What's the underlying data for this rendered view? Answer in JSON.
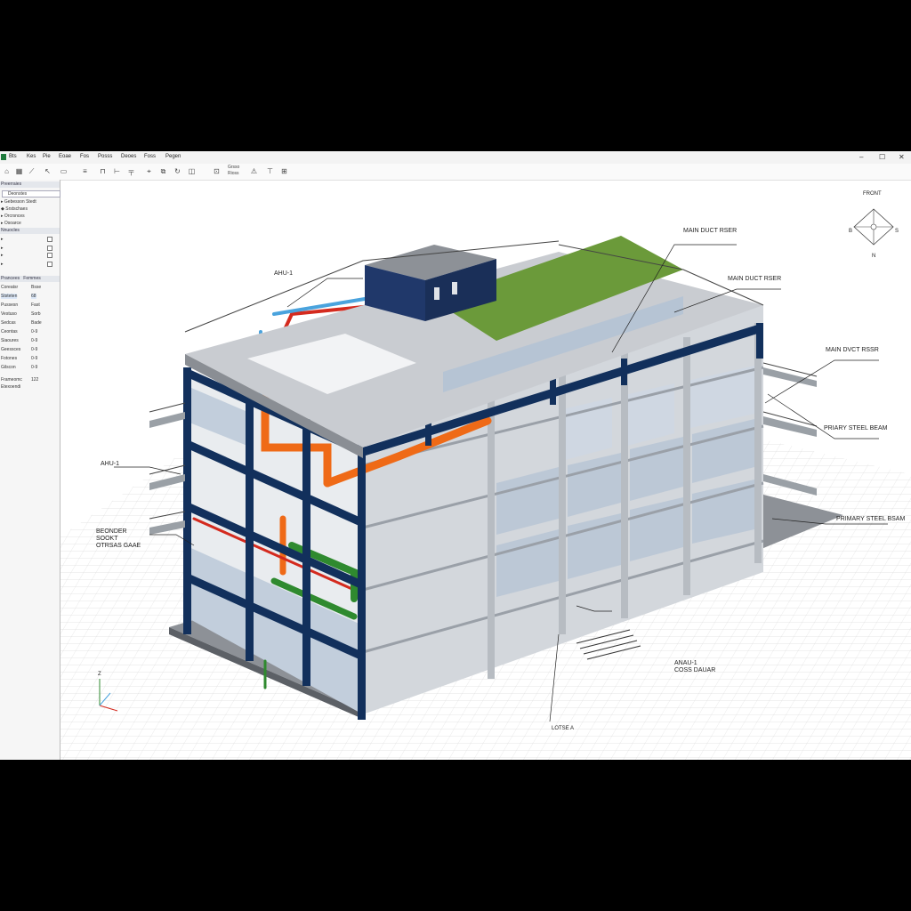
{
  "menu": {
    "items": [
      "Bts",
      "Kes",
      "Pie",
      "Eoae",
      "Fos",
      "Posss",
      "Deoes",
      "Foss",
      "Pegen"
    ]
  },
  "window_controls": {
    "minimize": "–",
    "maximize": "☐",
    "close": "✕"
  },
  "toolbar": {
    "icon_labels": [
      "Grsso",
      "Rioss"
    ]
  },
  "left_panel": {
    "header": "Preerraies",
    "search_value": "Deonstes",
    "tree": [
      "Gebesson Stedt",
      "Srstschaes",
      "Orcrsnces",
      "Osoarce"
    ],
    "section2_header": "Nnuocles",
    "section2_rows": [
      "",
      "",
      "",
      "",
      ""
    ],
    "props_header": "Prancees",
    "props_header_value": "Femmes",
    "props": [
      {
        "label": "Coreatsr",
        "value": "Bsse"
      },
      {
        "label": "Ststeten",
        "value": "68"
      },
      {
        "label": "Pussesn",
        "value": "Fast"
      },
      {
        "label": "Vestuso",
        "value": "Sorb"
      },
      {
        "label": "Sedcas",
        "value": "Bade"
      },
      {
        "label": "Ceontas",
        "value": "0-9"
      },
      {
        "label": "Siaoures",
        "value": "0-9"
      },
      {
        "label": "Geessces",
        "value": "0-9"
      },
      {
        "label": "Fotones",
        "value": "0-9"
      },
      {
        "label": "Gilscon",
        "value": "0-9"
      }
    ],
    "footer1": "Frameomc",
    "footer1_value": "122",
    "footer2": "Etexoendi"
  },
  "viewport": {
    "labels": {
      "main_duct_1": "MAIN DUCT RSER",
      "main_duct_2": "MAIN DUCT RSER",
      "main_duct_3": "MAIN DVCT RSSR",
      "ahu_top": "AHU-1",
      "ahu_left": "AHU-1",
      "primary_beam_1": "PRIARY STEEL BEAM",
      "primary_beam_2": "PRIMARY STEEL BSAM",
      "secondary_beam": [
        "BEONDER",
        "SOOKT",
        "OTRSAS GAAE"
      ],
      "ahu_bottom": [
        "ANAU-1",
        "COSS DAUAR"
      ],
      "bottom_tag": "LOTSE A"
    },
    "view_cube": {
      "top": "FRONT",
      "left": "B",
      "right": "S",
      "bottom": "N"
    },
    "axis": {
      "z": "Z"
    }
  },
  "colors": {
    "steel": "#12305c",
    "duct_red": "#d42a1e",
    "duct_orange": "#ef6a17",
    "duct_blue": "#4aa3dd",
    "pipe_green": "#2f8a2f",
    "green_roof": "#6b9a3a",
    "glass": "#c2cedc"
  }
}
